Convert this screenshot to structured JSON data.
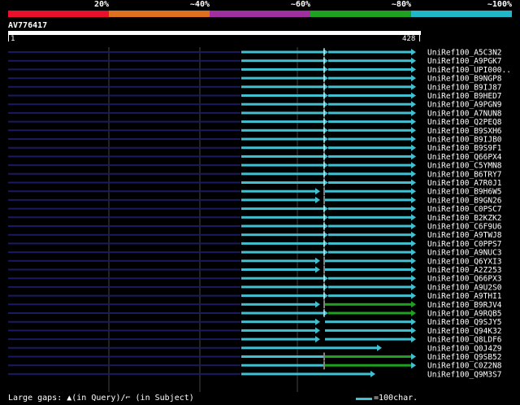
{
  "header": {
    "scale_labels": [
      "20%",
      "~40%",
      "~60%",
      "~80%",
      "~100%"
    ],
    "score_colors": [
      "#e8102a",
      "#e07020",
      "#a030a0",
      "#20a020",
      "#20b8c8"
    ]
  },
  "query": {
    "id": "AV776417",
    "start": "1",
    "end": "428"
  },
  "colors": {
    "hit": "#40c0d0",
    "hit_green": "#20a020",
    "dark_line": "#1a1a60",
    "grid": "#444444"
  },
  "hits": [
    {
      "name": "UniRef100_A5C3N2",
      "style": "full"
    },
    {
      "name": "UniRef100_A9PGK7",
      "style": "full"
    },
    {
      "name": "UniRef100_UPI000..",
      "style": "full"
    },
    {
      "name": "UniRef100_B9NGP8",
      "style": "full"
    },
    {
      "name": "UniRef100_B9IJ87",
      "style": "full"
    },
    {
      "name": "UniRef100_B9HED7",
      "style": "full"
    },
    {
      "name": "UniRef100_A9PGN9",
      "style": "full"
    },
    {
      "name": "UniRef100_A7NUN8",
      "style": "full"
    },
    {
      "name": "UniRef100_Q2PEQ8",
      "style": "full"
    },
    {
      "name": "UniRef100_B9SXH6",
      "style": "full"
    },
    {
      "name": "UniRef100_B9IJB0",
      "style": "full"
    },
    {
      "name": "UniRef100_B9S9F1",
      "style": "full"
    },
    {
      "name": "UniRef100_Q66PX4",
      "style": "full"
    },
    {
      "name": "UniRef100_C5YMN8",
      "style": "full"
    },
    {
      "name": "UniRef100_B6TRY7",
      "style": "full"
    },
    {
      "name": "UniRef100_A7R0J1",
      "style": "full"
    },
    {
      "name": "UniRef100_B9H6W5",
      "style": "gap"
    },
    {
      "name": "UniRef100_B9GN26",
      "style": "gap"
    },
    {
      "name": "UniRef100_C0PSC7",
      "style": "full"
    },
    {
      "name": "UniRef100_B2KZK2",
      "style": "full"
    },
    {
      "name": "UniRef100_C6F9U6",
      "style": "full"
    },
    {
      "name": "UniRef100_A9TWJ8",
      "style": "full"
    },
    {
      "name": "UniRef100_C0PPS7",
      "style": "full"
    },
    {
      "name": "UniRef100_A9NUC3",
      "style": "full"
    },
    {
      "name": "UniRef100_Q6YXI3",
      "style": "gap"
    },
    {
      "name": "UniRef100_A2Z253",
      "style": "gap"
    },
    {
      "name": "UniRef100_Q66PX3",
      "style": "full"
    },
    {
      "name": "UniRef100_A9U2S0",
      "style": "full"
    },
    {
      "name": "UniRef100_A9THI1",
      "style": "full"
    },
    {
      "name": "UniRef100_B9RJV4",
      "style": "gap-green"
    },
    {
      "name": "UniRef100_A9RQB5",
      "style": "full-green"
    },
    {
      "name": "UniRef100_Q9SJY5",
      "style": "left"
    },
    {
      "name": "UniRef100_Q94K32",
      "style": "left"
    },
    {
      "name": "UniRef100_Q8LDF6",
      "style": "left"
    },
    {
      "name": "UniRef100_Q0J4Z9",
      "style": "short"
    },
    {
      "name": "UniRef100_Q9SB52",
      "style": "green-tail"
    },
    {
      "name": "UniRef100_C0Z2N8",
      "style": "green-tail"
    },
    {
      "name": "UniRef100_Q9M3S7",
      "style": "short2"
    }
  ],
  "footer": {
    "gaps_text": "Large gaps: ▲(in Query)/⌐ (in Subject)",
    "legend_text": "=100char."
  }
}
